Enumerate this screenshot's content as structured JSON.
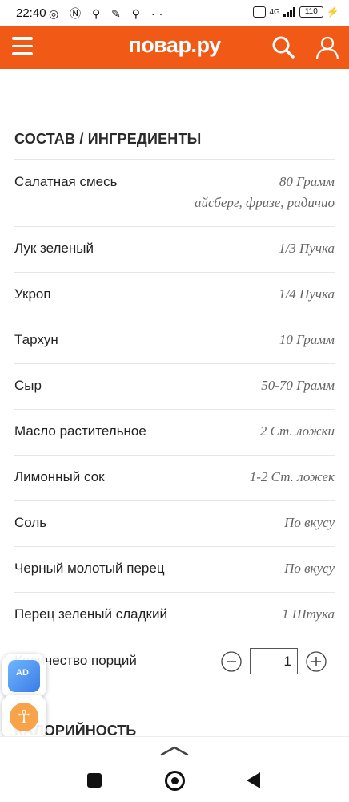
{
  "status_bar": {
    "time": "22:40",
    "left_icons": "◎ Ⓝ ⚲ ✎ ⚲ ··",
    "network": "4G",
    "battery": "110"
  },
  "header": {
    "logo": "повар.ру",
    "brand_color": "#f15a16"
  },
  "ingredients": {
    "title": "СОСТАВ / ИНГРЕДИЕНТЫ",
    "items": [
      {
        "name": "Салатная смесь",
        "amount": "80 Грамм",
        "note": "айсберг, фризе, радичио"
      },
      {
        "name": "Лук зеленый",
        "amount": "1/3 Пучка"
      },
      {
        "name": "Укроп",
        "amount": "1/4 Пучка"
      },
      {
        "name": "Тархун",
        "amount": "10 Грамм"
      },
      {
        "name": "Сыр",
        "amount": "50-70 Грамм"
      },
      {
        "name": "Масло растительное",
        "amount": "2 Ст. ложки"
      },
      {
        "name": "Лимонный сок",
        "amount": "1-2 Ст. ложек"
      },
      {
        "name": "Соль",
        "amount": "По вкусу"
      },
      {
        "name": "Черный молотый перец",
        "amount": "По вкусу"
      },
      {
        "name": "Перец зеленый сладкий",
        "amount": "1 Штука"
      }
    ]
  },
  "portions": {
    "label": "Количество порций",
    "value": "1"
  },
  "calories": {
    "title": "КАЛОРИЙНОСТЬ"
  },
  "floating": {
    "ad_label": "AD",
    "accessibility_glyph": "☥"
  }
}
